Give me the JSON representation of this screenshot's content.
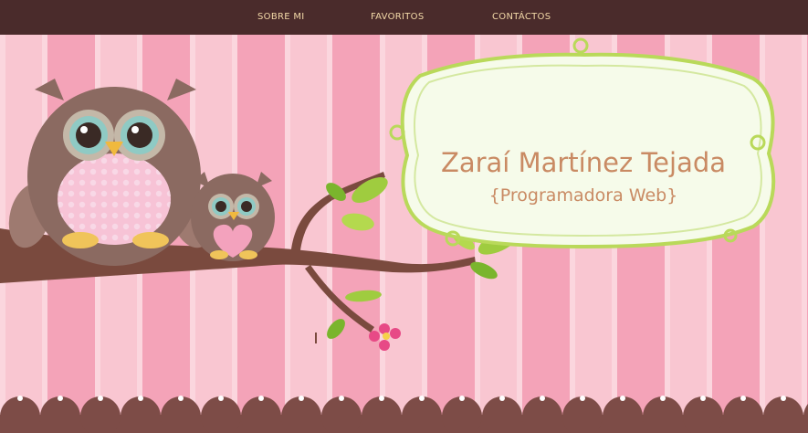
{
  "nav": {
    "links": [
      {
        "label": "SOBRE MI"
      },
      {
        "label": "FAVORITOS"
      },
      {
        "label": "CONTÁCTOS"
      }
    ]
  },
  "hero": {
    "name": "Zaraí Martínez Tejada",
    "subtitle": "{Programadora Web}"
  },
  "colors": {
    "navbar": "#4a2b2b",
    "nav_text": "#f3d9a8",
    "stripe_light": "#f9c6d1",
    "stripe_dark": "#f4a3b8",
    "title_text": "#c98a63",
    "frame_green": "#b9d95a"
  }
}
